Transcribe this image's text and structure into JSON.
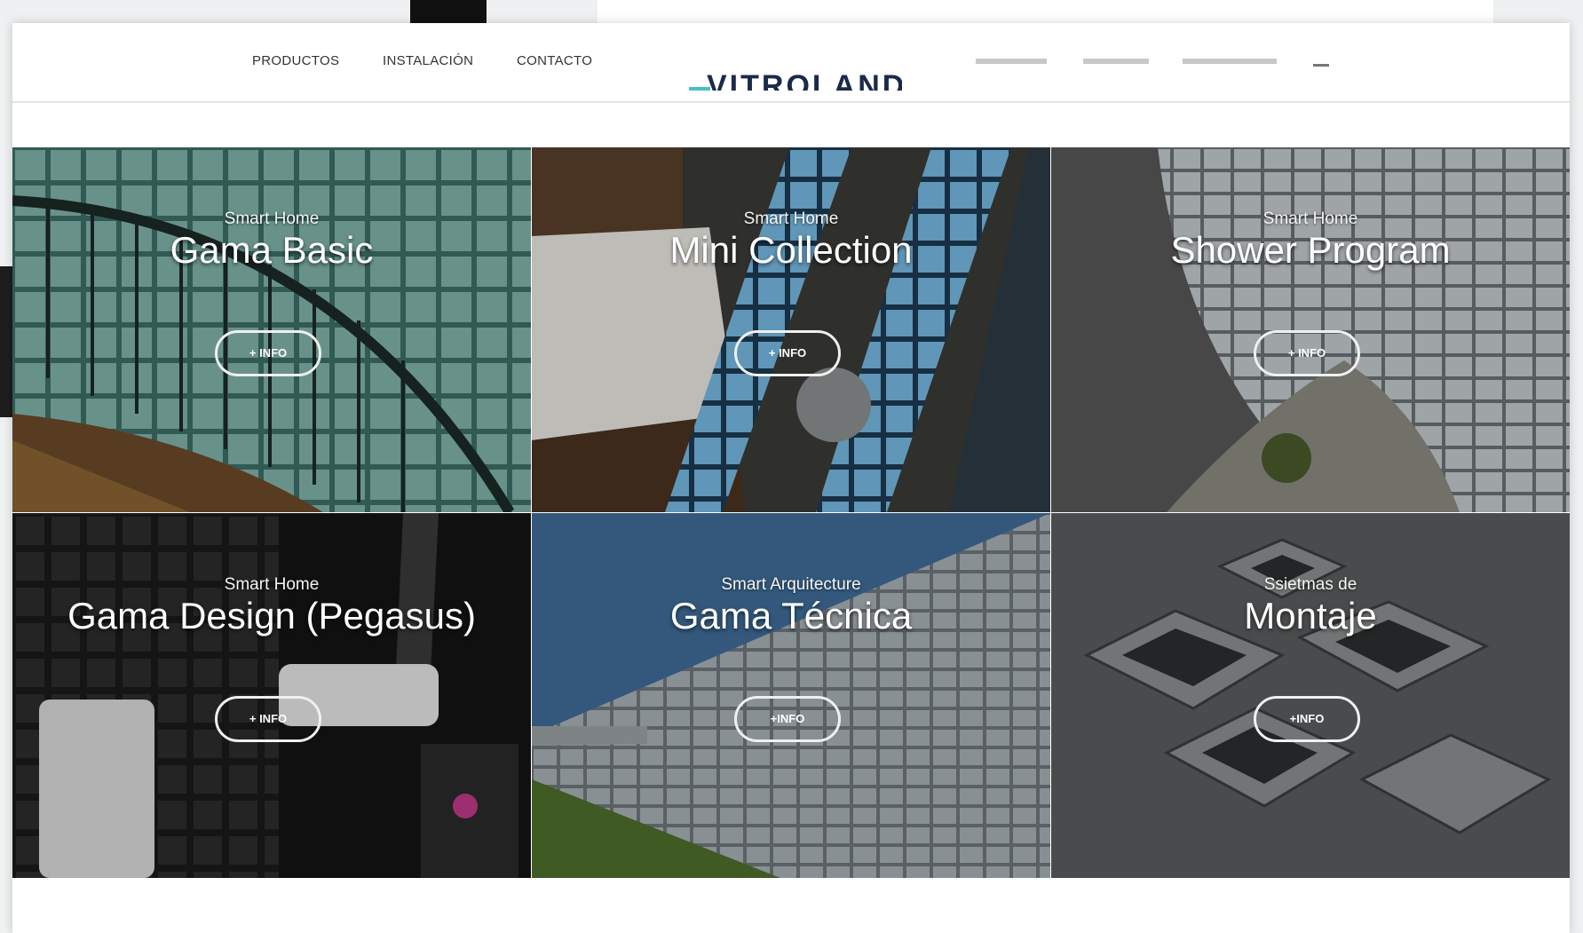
{
  "nav": {
    "items": [
      "PRODUCTOS",
      "INSTALACIÓN",
      "CONTACTO"
    ],
    "logo_text": "VITROLAND"
  },
  "tiles": [
    {
      "subtitle": "Smart Home",
      "title": "Gama Basic",
      "button": "+ INFO"
    },
    {
      "subtitle": "Smart Home",
      "title": "Mini Collection",
      "button": "+ INFO"
    },
    {
      "subtitle": "Smart Home",
      "title": "Shower Program",
      "button": "+ INFO"
    },
    {
      "subtitle": "Smart Home",
      "title": "Gama Design (Pegasus)",
      "button": "+ INFO"
    },
    {
      "subtitle": "Smart Arquitecture",
      "title": "Gama Técnica",
      "button": "+INFO"
    },
    {
      "subtitle": "Ssietmas de",
      "title": "Montaje",
      "button": "+INFO"
    }
  ],
  "colors": {
    "accent": "#48bfc9",
    "logo": "#1a2a4a"
  }
}
